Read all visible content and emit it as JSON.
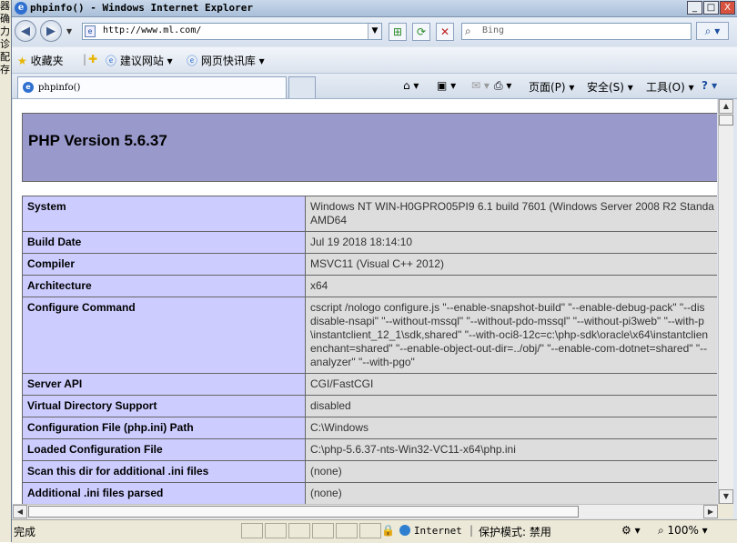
{
  "left_strip": [
    "器",
    "确",
    "",
    "力",
    "诊",
    "配",
    "存"
  ],
  "window": {
    "title": "phpinfo() - Windows Internet Explorer",
    "controls": {
      "minimize": "_",
      "maximize": "□",
      "close": "X"
    }
  },
  "nav": {
    "back_icon": "back-arrow-icon",
    "forward_icon": "forward-arrow-icon",
    "address": "http://www.ml.com/",
    "search_placeholder": "Bing",
    "search_glyph": "⌕",
    "compat_glyph": "⊞",
    "refresh_glyph": "⟳",
    "stop_glyph": "✕"
  },
  "favorites": {
    "label": "收藏夹",
    "items": [
      "建议网站 ▾",
      "网页快讯库 ▾"
    ]
  },
  "tab": {
    "label": "phpinfo()"
  },
  "command_bar": {
    "home": "⌂ ▾",
    "feeds": "▣ ▾",
    "mail": "✉ ▾",
    "print": "⎙ ▾",
    "page": "页面(P) ▾",
    "safety": "安全(S) ▾",
    "tools": "工具(O) ▾",
    "help": "? ▾"
  },
  "page": {
    "heading": "PHP Version 5.6.37",
    "rows": [
      {
        "key": "System",
        "lines": [
          "Windows NT WIN-H0GPRO05PI9 6.1 build 7601 (Windows Server 2008 R2 Standa",
          "AMD64"
        ]
      },
      {
        "key": "Build Date",
        "lines": [
          "Jul 19 2018 18:14:10"
        ]
      },
      {
        "key": "Compiler",
        "lines": [
          "MSVC11 (Visual C++ 2012)"
        ]
      },
      {
        "key": "Architecture",
        "lines": [
          "x64"
        ]
      },
      {
        "key": "Configure Command",
        "lines": [
          "cscript /nologo configure.js \"--enable-snapshot-build\" \"--enable-debug-pack\" \"--dis",
          "disable-nsapi\" \"--without-mssql\" \"--without-pdo-mssql\" \"--without-pi3web\" \"--with-p",
          "\\instantclient_12_1\\sdk,shared\" \"--with-oci8-12c=c:\\php-sdk\\oracle\\x64\\instantclien",
          "enchant=shared\" \"--enable-object-out-dir=../obj/\" \"--enable-com-dotnet=shared\" \"--",
          "analyzer\" \"--with-pgo\""
        ]
      },
      {
        "key": "Server API",
        "lines": [
          "CGI/FastCGI"
        ]
      },
      {
        "key": "Virtual Directory Support",
        "lines": [
          "disabled"
        ]
      },
      {
        "key": "Configuration File (php.ini) Path",
        "lines": [
          "C:\\Windows"
        ]
      },
      {
        "key": "Loaded Configuration File",
        "lines": [
          "C:\\php-5.6.37-nts-Win32-VC11-x64\\php.ini"
        ]
      },
      {
        "key": "Scan this dir for additional .ini files",
        "lines": [
          "(none)"
        ]
      },
      {
        "key": "Additional .ini files parsed",
        "lines": [
          "(none)"
        ]
      }
    ]
  },
  "status": {
    "text": "完成",
    "zone": "Internet",
    "protected_mode": "保护模式: 禁用",
    "zoom": "100%"
  },
  "colors": {
    "php_header": "#9999cc",
    "php_key_cell": "#ccccff",
    "php_value_cell": "#dddddd"
  }
}
